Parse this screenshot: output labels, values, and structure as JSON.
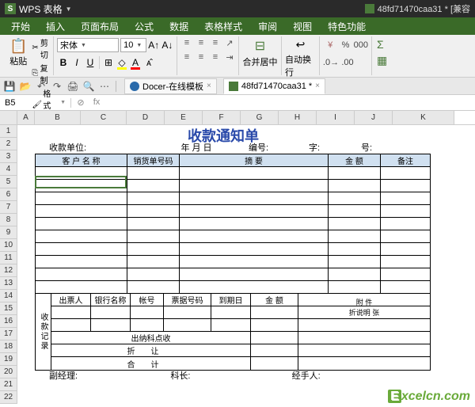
{
  "titlebar": {
    "app_name": "WPS 表格",
    "doc_name": "48fd71470caa31 * [兼容"
  },
  "menubar": {
    "tabs": [
      "开始",
      "插入",
      "页面布局",
      "公式",
      "数据",
      "表格样式",
      "审阅",
      "视图",
      "特色功能"
    ]
  },
  "ribbon": {
    "paste": {
      "label": "粘贴",
      "cut": "剪切",
      "copy": "复制",
      "format_painter": "格式刷"
    },
    "font": {
      "name": "宋体",
      "size": "10"
    },
    "merge": {
      "label": "合并居中"
    },
    "wrap": {
      "label": "自动换行"
    }
  },
  "qat": {
    "docer_tab": "Docer-在线模板",
    "file_tab": "48fd71470caa31 *"
  },
  "formula": {
    "namebox": "B5",
    "fx": "fx"
  },
  "columns": [
    "A",
    "B",
    "C",
    "D",
    "E",
    "F",
    "G",
    "H",
    "I",
    "J",
    "K"
  ],
  "rows": [
    "1",
    "2",
    "3",
    "4",
    "5",
    "6",
    "7",
    "8",
    "9",
    "10",
    "11",
    "12",
    "13",
    "14",
    "15",
    "16",
    "17",
    "18",
    "19",
    "20",
    "21",
    "22"
  ],
  "form": {
    "title": "收款通知单",
    "meta": {
      "unit": "收款单位:",
      "date": "年  月  日",
      "serial": "编号:",
      "zi": "字:",
      "hao": "号:"
    },
    "headers": {
      "customer": "客 户 名 称",
      "order_no": "销货单号码",
      "summary": "摘    要",
      "amount": "金  额",
      "remark": "备注"
    },
    "sub": {
      "vlabel": "收款记录",
      "hdr": {
        "drawer": "出票人",
        "bank": "银行名称",
        "account": "帐号",
        "bill_no": "票据号码",
        "due": "到期日",
        "sub_amount": "金  额",
        "attach": "附    件",
        "fold_desc": "折说明  张"
      },
      "cash": "出纳科点收",
      "fold": "折让",
      "total": "合计"
    },
    "footer": {
      "vice": "副经理:",
      "chief": "科长:",
      "handler": "经手人:"
    }
  },
  "watermark": {
    "brand_E": "E",
    "brand_rest": "xcelcn.com"
  }
}
